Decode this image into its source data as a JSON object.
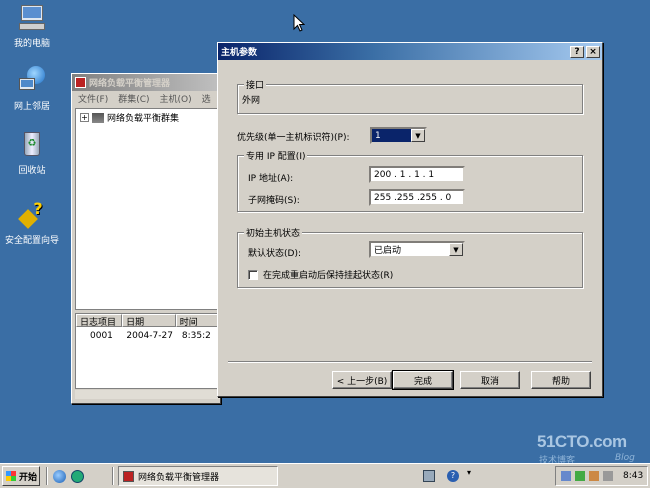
{
  "desktop": {
    "icons": [
      {
        "label": "我的电脑",
        "icon": "my-computer-icon"
      },
      {
        "label": "网上邻居",
        "icon": "network-places-icon"
      },
      {
        "label": "回收站",
        "icon": "recycle-bin-icon"
      },
      {
        "label": "安全配置向导",
        "icon": "security-wizard-icon"
      }
    ]
  },
  "nlb_manager": {
    "title": "网络负载平衡管理器",
    "menu": [
      "文件(F)",
      "群集(C)",
      "主机(O)",
      "选"
    ],
    "tree_root": "网络负载平衡群集",
    "log_headers": [
      "日志项目",
      "日期",
      "时间"
    ],
    "log_rows": [
      {
        "item": "0001",
        "date": "2004-7-27",
        "time": "8:35:2"
      }
    ]
  },
  "dialog": {
    "title": "主机参数",
    "interface_group": "接口",
    "interface_value": "外网",
    "priority_label": "优先级(单一主机标识符)(P):",
    "priority_value": "1",
    "dedicated_ip_group": "专用 IP 配置(I)",
    "ip_label": "IP 地址(A):",
    "ip_value": "200 . 1 . 1 . 1",
    "mask_label": "子网掩码(S):",
    "mask_value": "255 .255 .255 . 0",
    "initial_state_group": "初始主机状态",
    "default_state_label": "默认状态(D):",
    "default_state_value": "已启动",
    "keep_suspended_label": "在完成重启动后保持挂起状态(R)",
    "keep_suspended_checked": false,
    "buttons": {
      "back": "< 上一步(B)",
      "finish": "完成",
      "cancel": "取消",
      "help": "帮助"
    },
    "help_btn": "?",
    "close_btn": "×"
  },
  "taskbar": {
    "start": "开始",
    "task": "网络负载平衡管理器",
    "clock": "8:43"
  },
  "watermark": {
    "site": "51CTO.com",
    "sub": "技术博客",
    "blog": "Blog"
  }
}
